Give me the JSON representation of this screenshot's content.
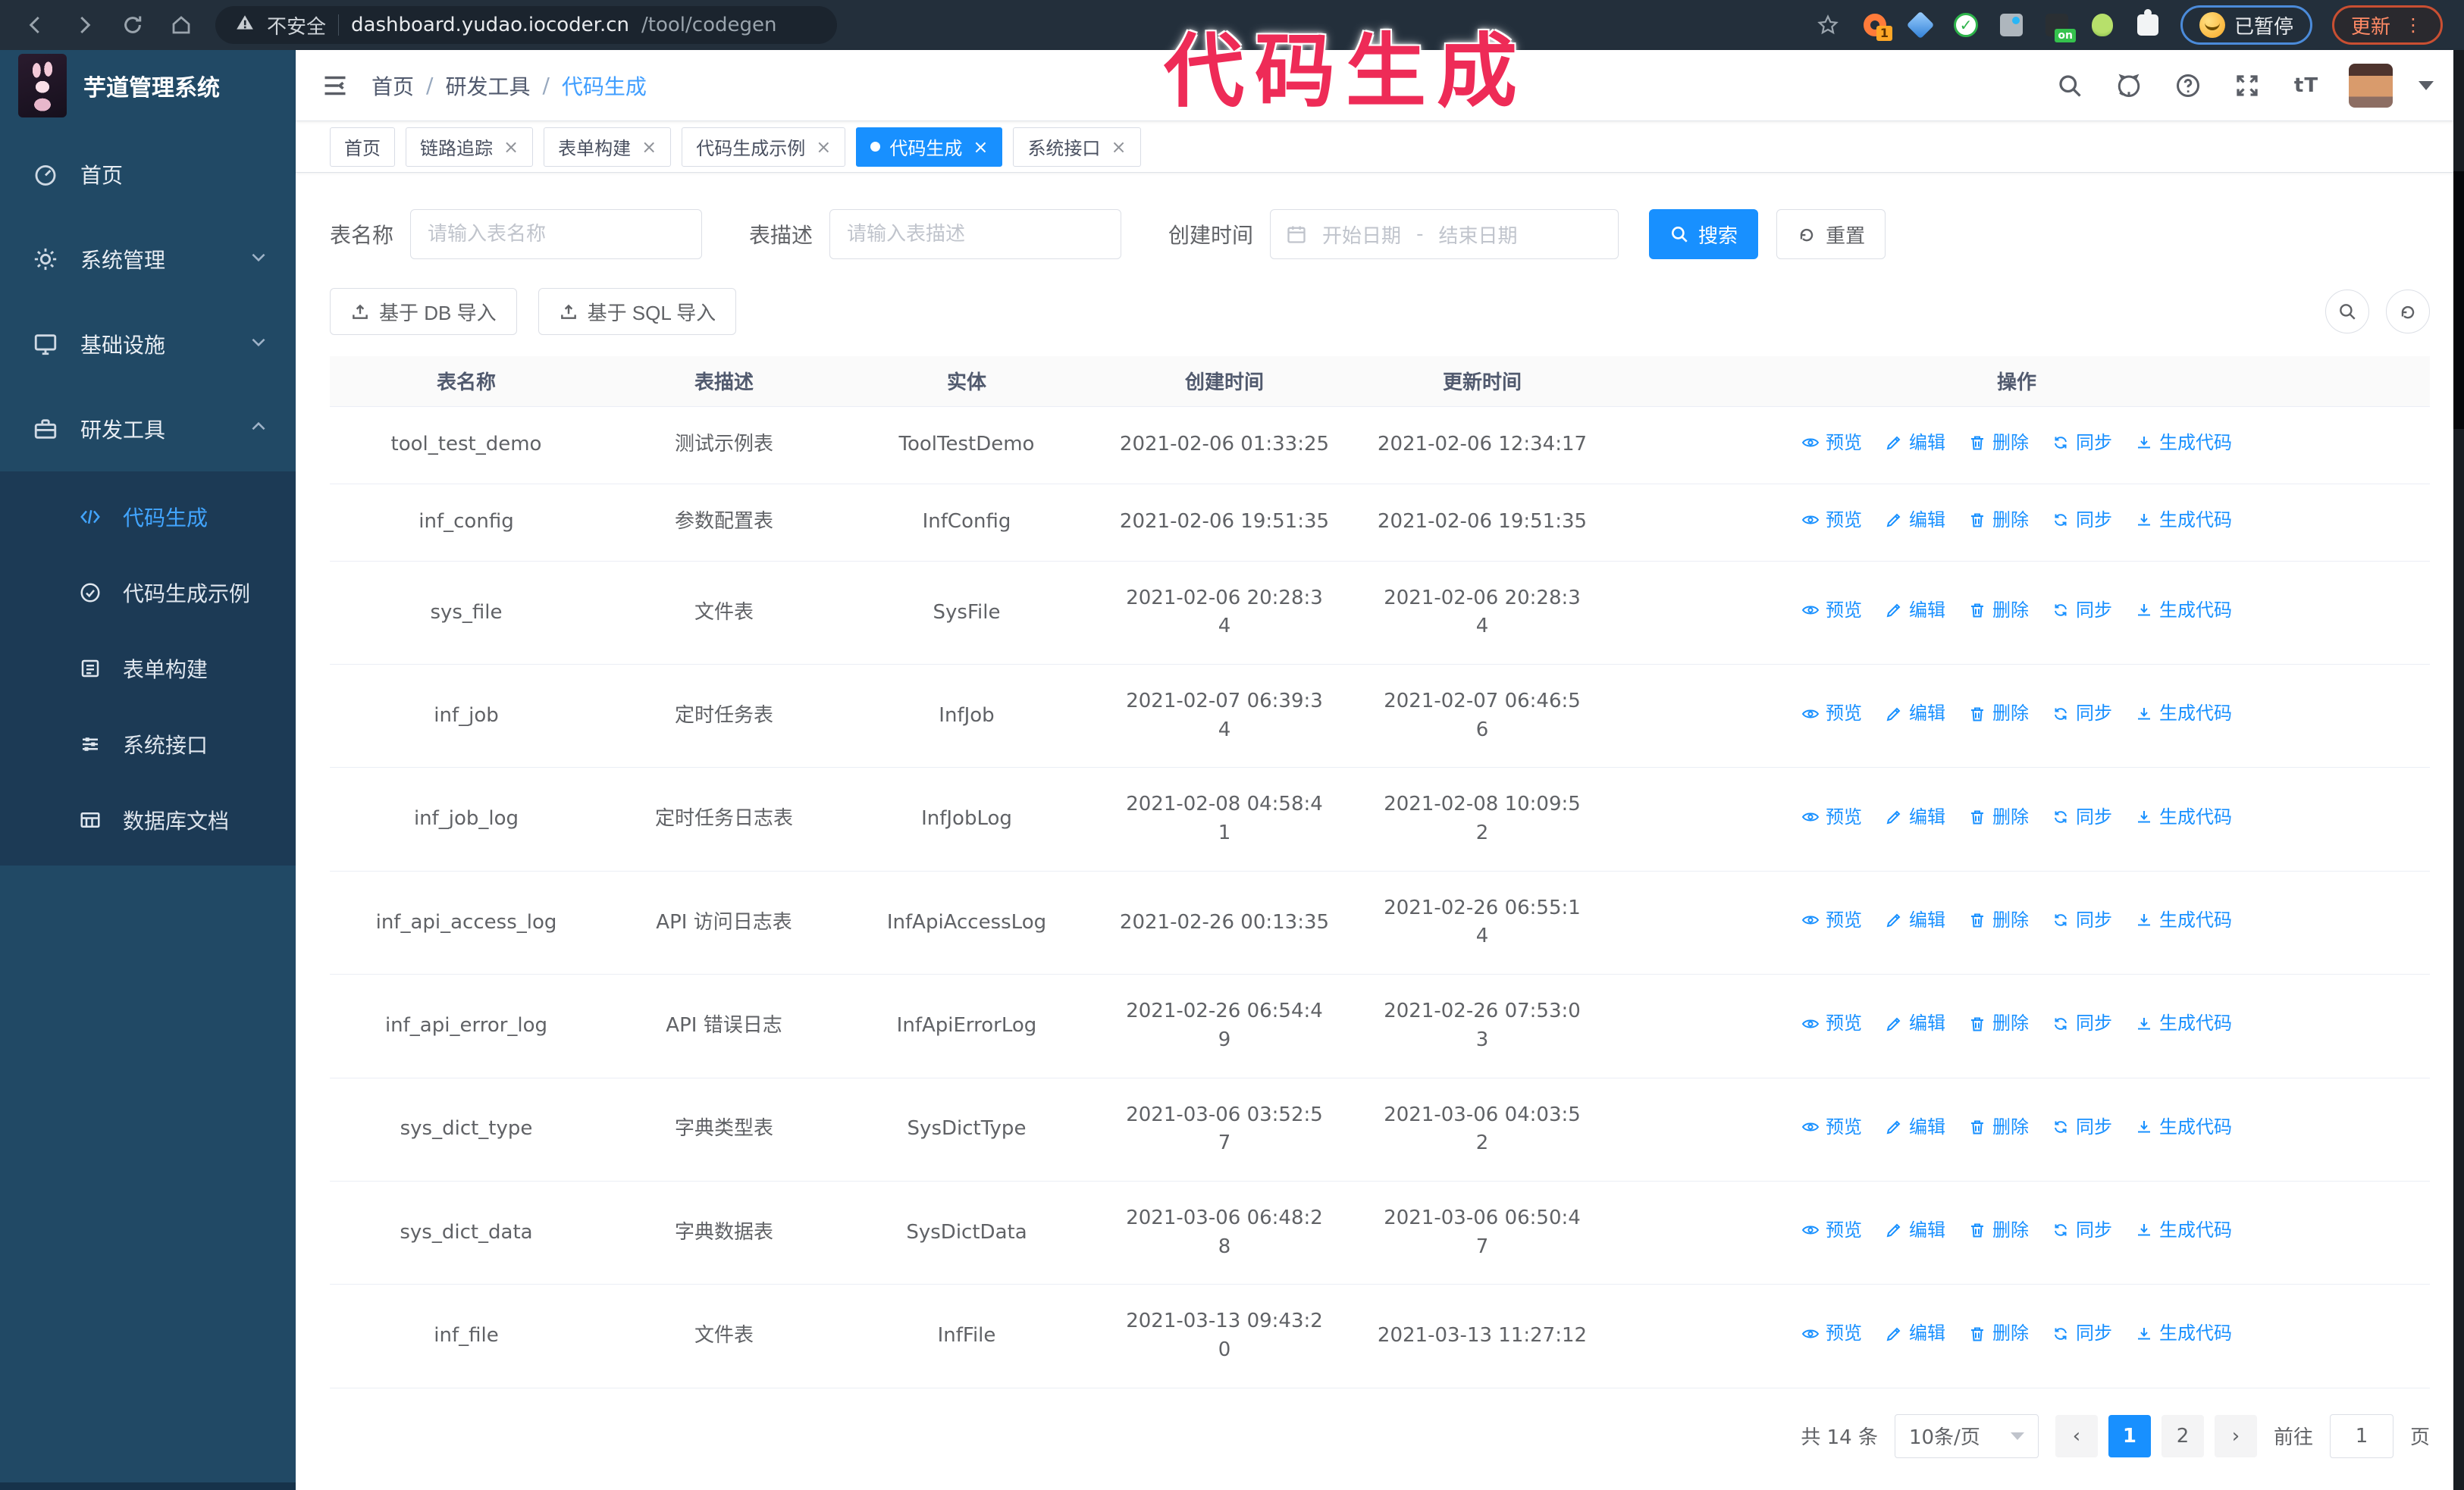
{
  "annotation": "代码生成",
  "browser": {
    "security_label": "不安全",
    "url_host": "dashboard.yudao.iocoder.cn",
    "url_path": "/tool/codegen",
    "ext_badge": "1",
    "ext_on_badge": "on",
    "paused_label": "已暂停",
    "update_label": "更新",
    "update_dots": "⋮"
  },
  "app": {
    "title": "芋道管理系统"
  },
  "breadcrumb": {
    "separator": "/",
    "items": [
      "首页",
      "研发工具",
      "代码生成"
    ]
  },
  "sidebar": {
    "items": [
      {
        "label": "首页"
      },
      {
        "label": "系统管理"
      },
      {
        "label": "基础设施"
      },
      {
        "label": "研发工具"
      }
    ],
    "sub_items": [
      {
        "label": "代码生成",
        "active": true
      },
      {
        "label": "代码生成示例",
        "active": false
      },
      {
        "label": "表单构建",
        "active": false
      },
      {
        "label": "系统接口",
        "active": false
      },
      {
        "label": "数据库文档",
        "active": false
      }
    ]
  },
  "tabs": [
    {
      "label": "首页",
      "closable": false,
      "active": false
    },
    {
      "label": "链路追踪",
      "closable": true,
      "active": false
    },
    {
      "label": "表单构建",
      "closable": true,
      "active": false
    },
    {
      "label": "代码生成示例",
      "closable": true,
      "active": false
    },
    {
      "label": "代码生成",
      "closable": true,
      "active": true
    },
    {
      "label": "系统接口",
      "closable": true,
      "active": false
    }
  ],
  "filters": {
    "name_label": "表名称",
    "name_placeholder": "请输入表名称",
    "desc_label": "表描述",
    "desc_placeholder": "请输入表描述",
    "time_label": "创建时间",
    "start_placeholder": "开始日期",
    "range_separator": "-",
    "end_placeholder": "结束日期",
    "search_label": "搜索",
    "reset_label": "重置"
  },
  "toolbar": {
    "db_import_label": "基于 DB 导入",
    "sql_import_label": "基于 SQL 导入"
  },
  "table": {
    "headers": [
      "表名称",
      "表描述",
      "实体",
      "创建时间",
      "更新时间",
      "操作"
    ],
    "actions": [
      {
        "key": "preview",
        "icon": "eye-icon",
        "label": "预览"
      },
      {
        "key": "edit",
        "icon": "edit-icon",
        "label": "编辑"
      },
      {
        "key": "delete",
        "icon": "delete-icon",
        "label": "删除"
      },
      {
        "key": "sync",
        "icon": "sync-icon",
        "label": "同步"
      },
      {
        "key": "generate",
        "icon": "download-icon",
        "label": "生成代码"
      }
    ],
    "rows": [
      {
        "name": "tool_test_demo",
        "desc": "测试示例表",
        "entity": "ToolTestDemo",
        "created": "2021-02-06 01:33:25",
        "updated": "2021-02-06 12:34:17",
        "created_wrap": false,
        "updated_wrap": false
      },
      {
        "name": "inf_config",
        "desc": "参数配置表",
        "entity": "InfConfig",
        "created": "2021-02-06 19:51:35",
        "updated": "2021-02-06 19:51:35",
        "created_wrap": false,
        "updated_wrap": false
      },
      {
        "name": "sys_file",
        "desc": "文件表",
        "entity": "SysFile",
        "created": "2021-02-06 20:28:34",
        "updated": "2021-02-06 20:28:34",
        "created_wrap": true,
        "updated_wrap": true
      },
      {
        "name": "inf_job",
        "desc": "定时任务表",
        "entity": "InfJob",
        "created": "2021-02-07 06:39:34",
        "updated": "2021-02-07 06:46:56",
        "created_wrap": true,
        "updated_wrap": true
      },
      {
        "name": "inf_job_log",
        "desc": "定时任务日志表",
        "entity": "InfJobLog",
        "created": "2021-02-08 04:58:41",
        "updated": "2021-02-08 10:09:52",
        "created_wrap": true,
        "updated_wrap": true
      },
      {
        "name": "inf_api_access_log",
        "desc": "API 访问日志表",
        "entity": "InfApiAccessLog",
        "created": "2021-02-26 00:13:35",
        "updated": "2021-02-26 06:55:14",
        "created_wrap": false,
        "updated_wrap": true
      },
      {
        "name": "inf_api_error_log",
        "desc": "API 错误日志",
        "entity": "InfApiErrorLog",
        "created": "2021-02-26 06:54:49",
        "updated": "2021-02-26 07:53:03",
        "created_wrap": true,
        "updated_wrap": true
      },
      {
        "name": "sys_dict_type",
        "desc": "字典类型表",
        "entity": "SysDictType",
        "created": "2021-03-06 03:52:57",
        "updated": "2021-03-06 04:03:52",
        "created_wrap": true,
        "updated_wrap": true
      },
      {
        "name": "sys_dict_data",
        "desc": "字典数据表",
        "entity": "SysDictData",
        "created": "2021-03-06 06:48:28",
        "updated": "2021-03-06 06:50:47",
        "created_wrap": true,
        "updated_wrap": true
      },
      {
        "name": "inf_file",
        "desc": "文件表",
        "entity": "InfFile",
        "created": "2021-03-13 09:43:20",
        "updated": "2021-03-13 11:27:12",
        "created_wrap": true,
        "updated_wrap": false
      }
    ]
  },
  "pagination": {
    "total_label": "共 14 条",
    "page_size_label": "10条/页",
    "pages": [
      "1",
      "2"
    ],
    "active_page": "1",
    "goto_label": "前往",
    "goto_value": "1",
    "page_suffix": "页"
  },
  "colors": {
    "primary": "#1890ff",
    "annotation": "#ee2b57",
    "sidebar": "#214965",
    "submenu": "#1c3a55"
  }
}
